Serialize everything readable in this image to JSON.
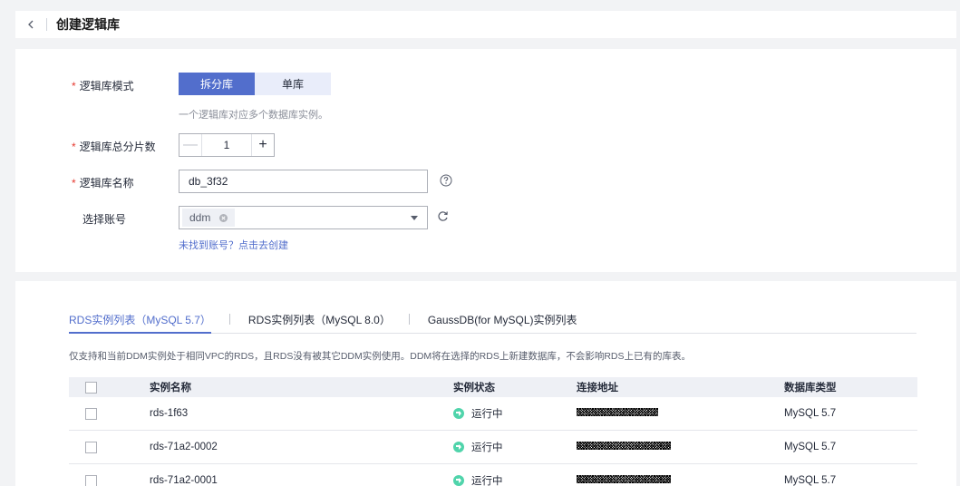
{
  "header": {
    "title": "创建逻辑库"
  },
  "form": {
    "mode": {
      "label": "逻辑库模式",
      "options": [
        "拆分库",
        "单库"
      ],
      "selected": "拆分库",
      "hint": "一个逻辑库对应多个数据库实例。"
    },
    "shards": {
      "label": "逻辑库总分片数",
      "value": "1",
      "minus": "—",
      "plus": "+"
    },
    "name": {
      "label": "逻辑库名称",
      "value": "db_3f32"
    },
    "account": {
      "label": "选择账号",
      "tag": "ddm",
      "link": "未找到账号？点击去创建"
    }
  },
  "tabs": [
    "RDS实例列表（MySQL 5.7）",
    "RDS实例列表（MySQL 8.0）",
    "GaussDB(for MySQL)实例列表"
  ],
  "notice": "仅支持和当前DDM实例处于相同VPC的RDS，且RDS没有被其它DDM实例使用。DDM将在选择的RDS上新建数据库，不会影响RDS上已有的库表。",
  "table": {
    "columns": [
      "实例名称",
      "实例状态",
      "连接地址",
      "数据库类型"
    ],
    "rows": [
      {
        "name": "rds-1f63",
        "status": "运行中",
        "type": "MySQL 5.7"
      },
      {
        "name": "rds-71a2-0002",
        "status": "运行中",
        "type": "MySQL 5.7"
      },
      {
        "name": "rds-71a2-0001",
        "status": "运行中",
        "type": "MySQL 5.7"
      }
    ]
  },
  "colors": {
    "primary": "#526ecc",
    "required": "#e5382f",
    "running": "#50d4ab"
  }
}
